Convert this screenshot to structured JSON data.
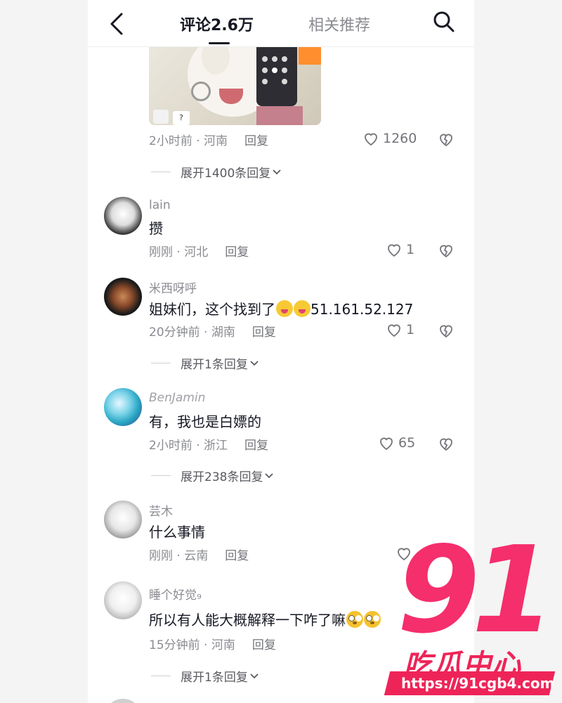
{
  "header": {
    "tab_comments": "评论2.6万",
    "tab_related": "相关推荐"
  },
  "top_comment": {
    "time": "2小时前 · 河南",
    "reply": "回复",
    "likes": "1260",
    "expand": "展开1400条回复"
  },
  "comments": [
    {
      "username": "lain",
      "text": "攒",
      "time": "刚刚 · 河北",
      "reply": "回复",
      "likes": "1"
    },
    {
      "username": "米西呀呼",
      "text": "姐妹们，这个找到了",
      "text_tail": "51.161.52.127",
      "time": "20分钟前 · 湖南",
      "reply": "回复",
      "likes": "1",
      "expand": "展开1条回复"
    },
    {
      "username": "BenJamin",
      "text": "有，我也是白嫖的",
      "time": "2小时前 · 浙江",
      "reply": "回复",
      "likes": "65",
      "expand": "展开238条回复"
    },
    {
      "username": "芸木",
      "text": "什么事情",
      "time": "刚刚 · 云南",
      "reply": "回复"
    },
    {
      "username": "睡个好觉₉",
      "text": "所以有人能大概解释一下咋了嘛",
      "time": "15分钟前 · 河南",
      "reply": "回复",
      "expand": "展开1条回复"
    }
  ],
  "media_label": "?",
  "watermark": {
    "number": "91",
    "brand": "吃瓜中心",
    "url": "https://91cgb4.com"
  },
  "colors": {
    "primary_text": "#161823",
    "secondary_text": "#8a8b91",
    "watermark": "#ee2458"
  }
}
